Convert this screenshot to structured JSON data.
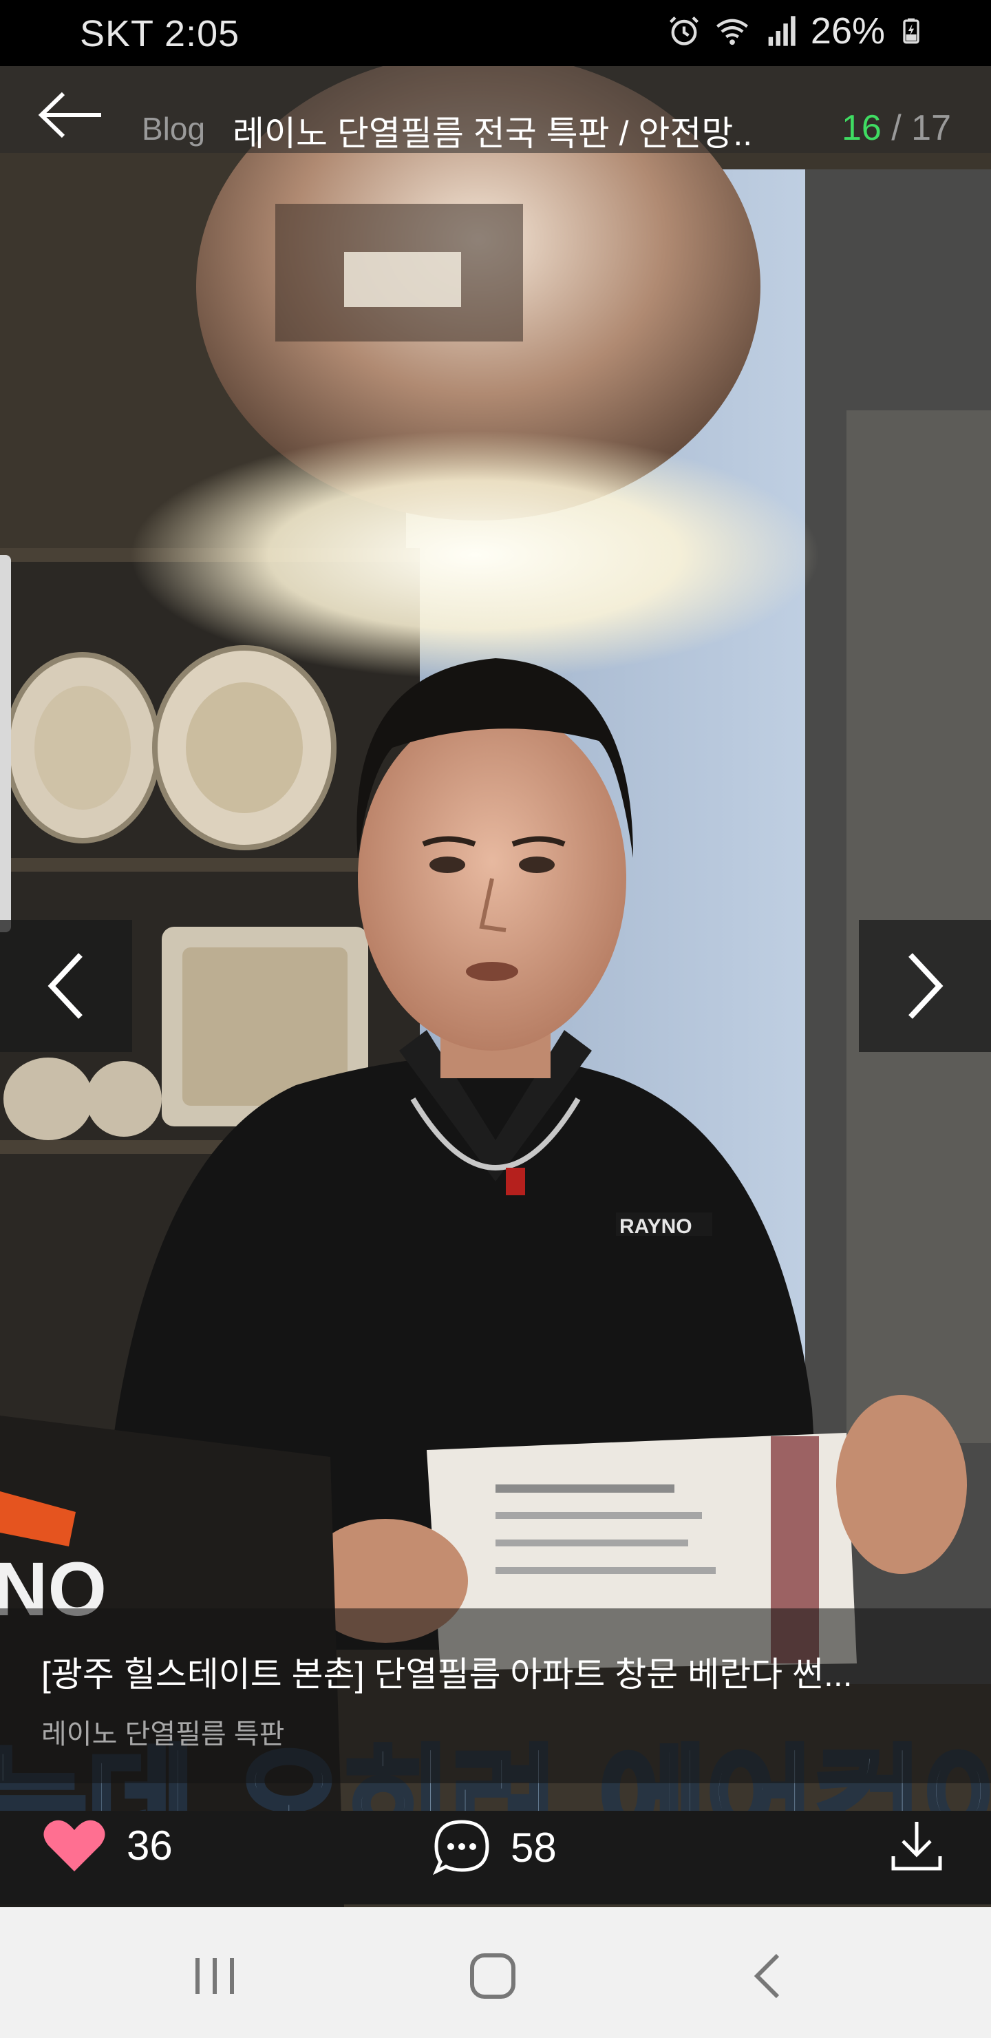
{
  "status_bar": {
    "carrier_time": "SKT 2:05",
    "battery": "26%",
    "icons": [
      "alarm-icon",
      "wifi-icon",
      "signal-icon",
      "battery-charging-icon"
    ]
  },
  "header": {
    "source": "Blog",
    "title": "레이노 단열필름 전국 특판 / 안전망..",
    "current": "16",
    "separator": " / ",
    "total": "17"
  },
  "photo": {
    "shirt_logo": "RAYNO",
    "overlay_text": "는데 오히려 에어컨이",
    "box_text": "NO"
  },
  "caption": {
    "title": "[광주 힐스테이트 본촌] 단열필름 아파트 창문 베란다 썬...",
    "author": "레이노 단열필름 특판"
  },
  "actions": {
    "likes": "36",
    "comments": "58"
  },
  "colors": {
    "accent_green": "#3fdc62",
    "heart": "#ff6f91"
  }
}
